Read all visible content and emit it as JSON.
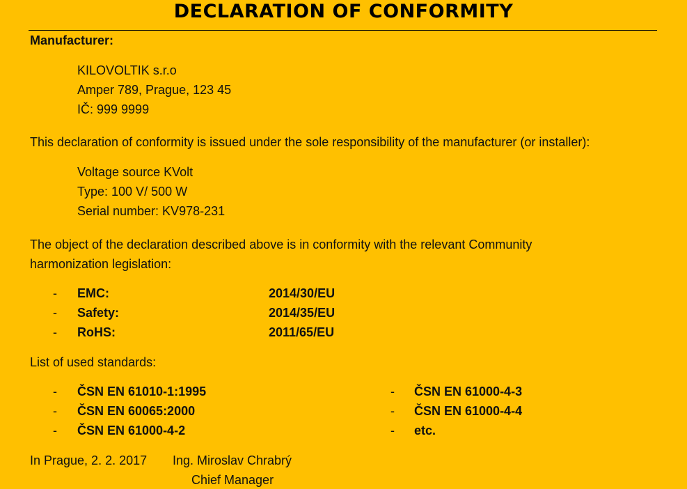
{
  "title": "DECLARATION OF CONFORMITY",
  "manufacturer_label": "Manufacturer:",
  "manufacturer": {
    "name": "KILOVOLTIK s.r.o",
    "address": "Amper 789, Prague, 123 45",
    "ic": "IČ: 999 9999"
  },
  "responsibility_text": "This declaration of conformity is issued under the sole responsibility of the manufacturer (or installer):",
  "product": {
    "name": "Voltage source KVolt",
    "type": "Type: 100 V/ 500 W",
    "serial": "Serial number: KV978-231"
  },
  "conformity_text_line1": "The object of the declaration described above is in conformity with the relevant Community",
  "conformity_text_line2": "harmonization legislation:",
  "legislation": [
    {
      "dash": "-",
      "name": "EMC:",
      "ref": "2014/30/EU"
    },
    {
      "dash": "-",
      "name": "Safety:",
      "ref": "2014/35/EU"
    },
    {
      "dash": "-",
      "name": "RoHS:",
      "ref": "2011/65/EU"
    }
  ],
  "standards_label": "List of used standards:",
  "standards_left": [
    {
      "dash": "-",
      "name": "ČSN EN 61010-1:1995"
    },
    {
      "dash": "-",
      "name": "ČSN EN 60065:2000"
    },
    {
      "dash": "-",
      "name": "ČSN EN 61000-4-2"
    }
  ],
  "standards_right": [
    {
      "dash": "-",
      "name": "ČSN EN 61000-4-3"
    },
    {
      "dash": "-",
      "name": "ČSN EN 61000-4-4"
    },
    {
      "dash": "-",
      "name": "etc."
    }
  ],
  "signature": {
    "place_date": "In Prague, 2. 2. 2017",
    "name": "Ing. Miroslav Chrabrý",
    "position": "Chief Manager"
  }
}
